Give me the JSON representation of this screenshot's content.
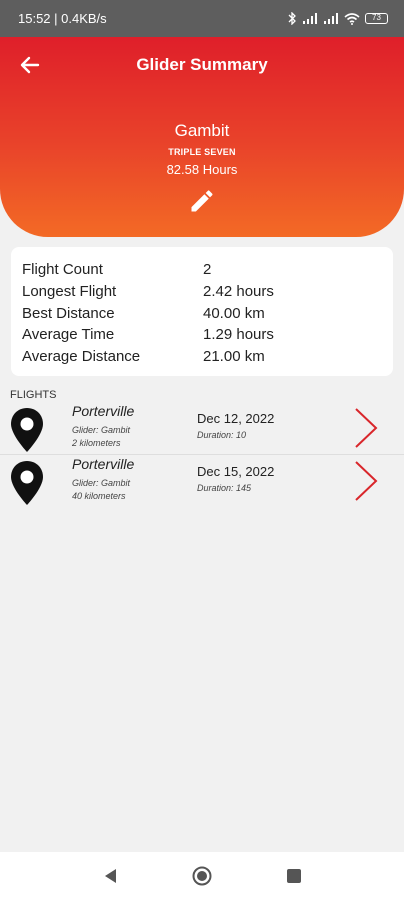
{
  "status_bar": {
    "time_speed": "15:52 | 0.4KB/s",
    "battery": "73"
  },
  "header": {
    "title": "Glider Summary",
    "glider_name": "Gambit",
    "glider_model": "TRIPLE SEVEN",
    "total_hours": "82.58 Hours"
  },
  "stats": [
    {
      "label": "Flight Count",
      "value": "2"
    },
    {
      "label": "Longest Flight",
      "value": "2.42 hours"
    },
    {
      "label": "Best Distance",
      "value": "40.00 km"
    },
    {
      "label": "Average Time",
      "value": "1.29 hours"
    },
    {
      "label": "Average Distance",
      "value": "21.00 km"
    }
  ],
  "flights_section_label": "FLIGHTS",
  "flights": [
    {
      "site": "Porterville",
      "glider": "Glider: Gambit",
      "distance": "2 kilometers",
      "date": "Dec 12, 2022",
      "duration": "Duration: 10"
    },
    {
      "site": "Porterville",
      "glider": "Glider: Gambit",
      "distance": "40 kilometers",
      "date": "Dec 15, 2022",
      "duration": "Duration: 145"
    }
  ],
  "colors": {
    "header_top": "#df1f2a",
    "header_bottom": "#f36a25",
    "chevron": "#d9262b",
    "status_bar": "#5e5e5e"
  },
  "icons": {
    "back": "arrow-left-icon",
    "edit": "pencil-icon",
    "flight": "map-pin-icon",
    "open": "chevron-right-icon"
  }
}
